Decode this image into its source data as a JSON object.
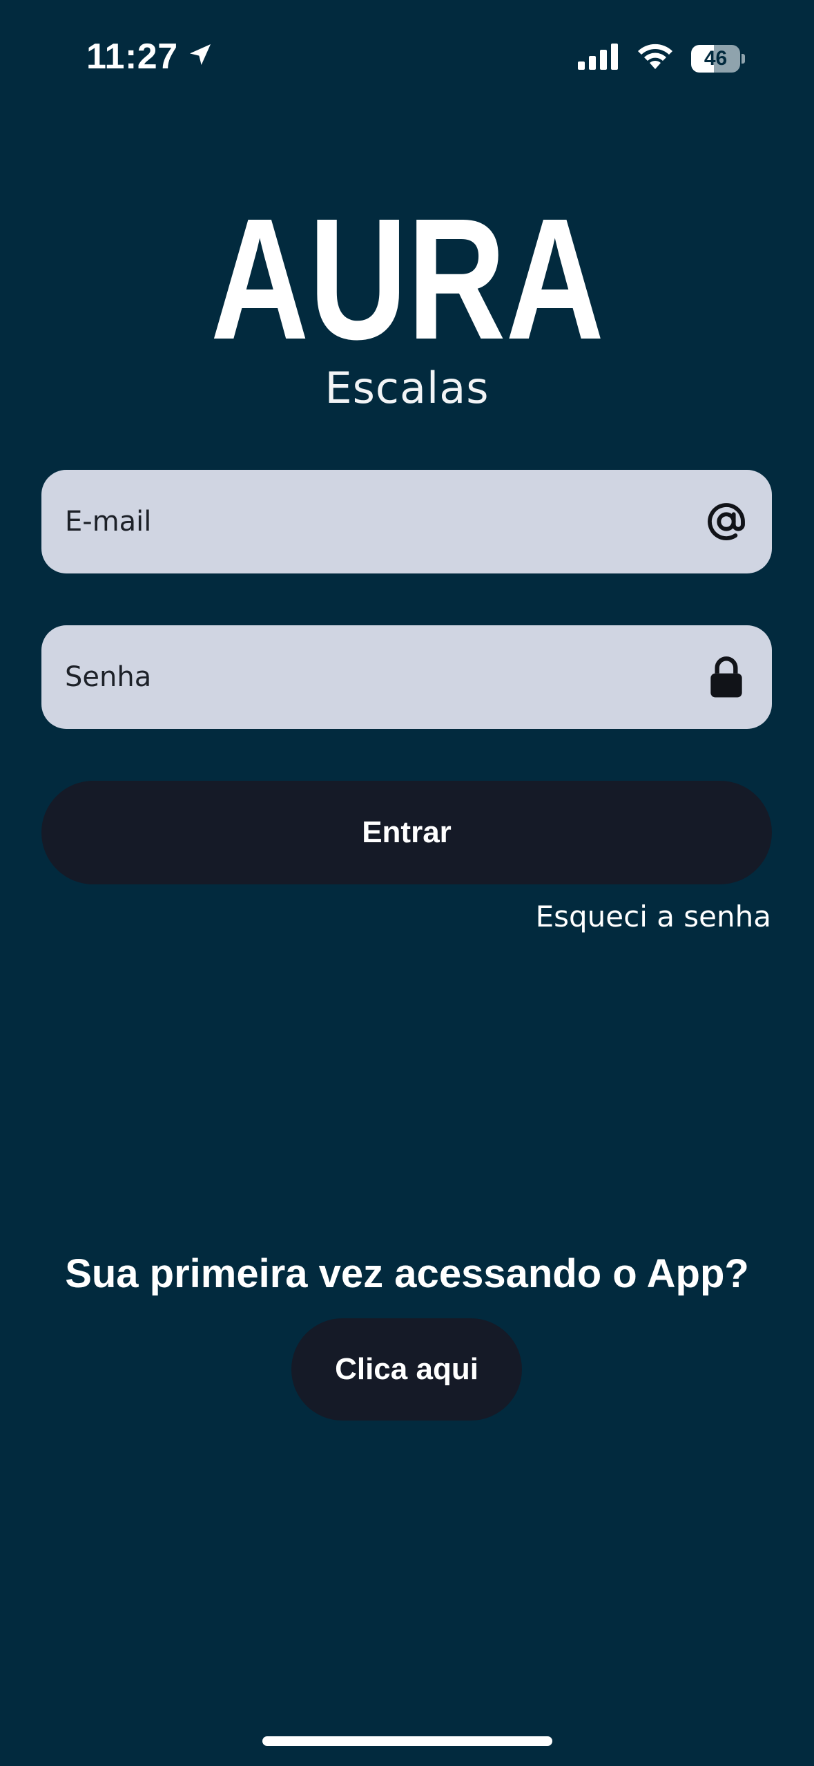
{
  "status_bar": {
    "time": "11:27",
    "battery_percent": "46",
    "battery_level": 0.46
  },
  "logo": {
    "brand": "AURA",
    "subtitle": "Escalas"
  },
  "login_form": {
    "email_placeholder": "E-mail",
    "password_placeholder": "Senha",
    "submit_label": "Entrar",
    "forgot_label": "Esqueci a senha"
  },
  "first_access": {
    "prompt": "Sua primeira vez acessando o App?",
    "button_label": "Clica aqui"
  },
  "icons": {
    "location": "location-arrow-icon",
    "signal": "cellular-signal-icon",
    "wifi": "wifi-icon",
    "battery": "battery-icon",
    "email": "at-sign-icon",
    "password": "lock-icon"
  },
  "colors": {
    "background": "#022a3e",
    "field": "#d0d5e2",
    "button": "#151a27",
    "text": "#ffffff"
  }
}
